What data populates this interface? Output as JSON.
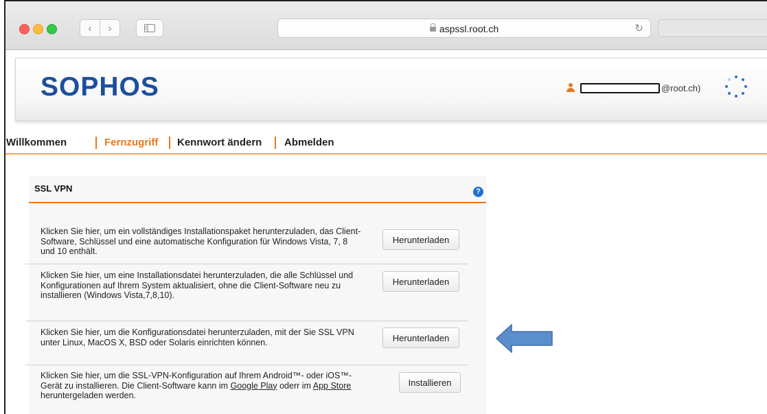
{
  "browser": {
    "url": "aspssl.root.ch",
    "back_glyph": "‹",
    "forward_glyph": "›",
    "reload_glyph": "↻"
  },
  "header": {
    "logo": "SOPHOS",
    "user_suffix": "@root.ch)"
  },
  "nav": {
    "items": [
      {
        "label": "Willkommen",
        "active": false
      },
      {
        "label": "Fernzugriff",
        "active": true
      },
      {
        "label": "Kennwort ändern",
        "active": false
      },
      {
        "label": "Abmelden",
        "active": false
      }
    ]
  },
  "panel": {
    "title": "SSL VPN",
    "help": "?",
    "rows": [
      {
        "text": "Klicken Sie hier, um ein vollständiges Installationspaket herunterzuladen, das Client-Software, Schlüssel und eine automatische Konfiguration für Windows Vista, 7, 8 und 10 enthält.",
        "button": "Herunterladen"
      },
      {
        "text": "Klicken Sie hier, um eine Installationsdatei herunterzuladen, die alle Schlüssel und Konfigurationen auf Ihrem System aktualisiert, ohne die Client-Software neu zu installieren (Windows Vista,7,8,10).",
        "button": "Herunterladen"
      },
      {
        "text": "Klicken Sie hier, um die Konfigurationsdatei herunterzuladen, mit der Sie SSL VPN unter Linux, MacOS X, BSD oder Solaris einrichten können.",
        "button": "Herunterladen"
      },
      {
        "text_before": "Klicken Sie hier, um die SSL-VPN-Konfiguration auf Ihrem Android™- oder iOS™-Gerät zu installieren. Die Client-Software kann im ",
        "link1": "Google Play",
        "text_middle": " oderr im ",
        "link2": "App Store",
        "text_after": " heruntergeladen werden.",
        "button": "Installieren"
      }
    ]
  },
  "colors": {
    "accent": "#e57a1b",
    "brand": "#1c4f9c",
    "arrow": "#5b8fcb"
  }
}
